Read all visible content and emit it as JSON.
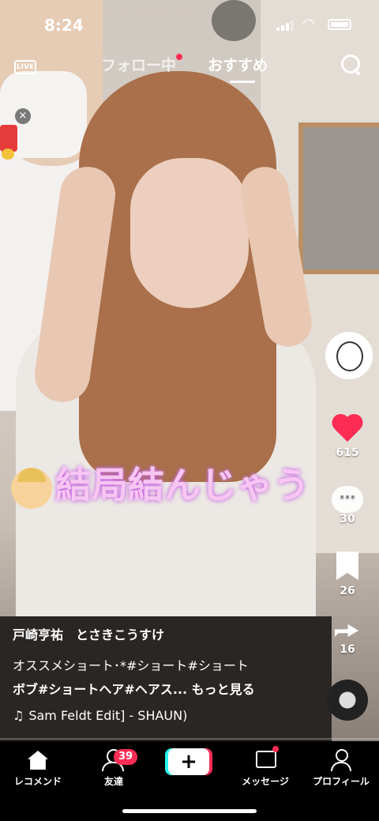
{
  "status": {
    "time": "8:24"
  },
  "nav": {
    "live_label": "LIVE",
    "tab_following": "フォロー中",
    "tab_recommended": "おすすめ"
  },
  "gift": {
    "close": "×"
  },
  "overlay_text": "結局結んじゃう",
  "side": {
    "likes": "615",
    "comments": "30",
    "saves": "26",
    "shares": "16"
  },
  "post": {
    "author": "戸崎亨祐　とさきこうすけ",
    "desc_line1": "オススメショート･*#ショート#ショート",
    "desc_line2": "ボブ#ショートヘア#ヘアス... もっと見る",
    "music": "Sam Feldt Edit] - SHAUN)"
  },
  "tabbar": {
    "home": "レコメンド",
    "friends": "友達",
    "friends_badge": "39",
    "create": "+",
    "messages": "メッセージ",
    "profile": "プロフィール"
  },
  "colors": {
    "accent": "#fe2c55",
    "overlay_text": "#f7c6f2"
  }
}
